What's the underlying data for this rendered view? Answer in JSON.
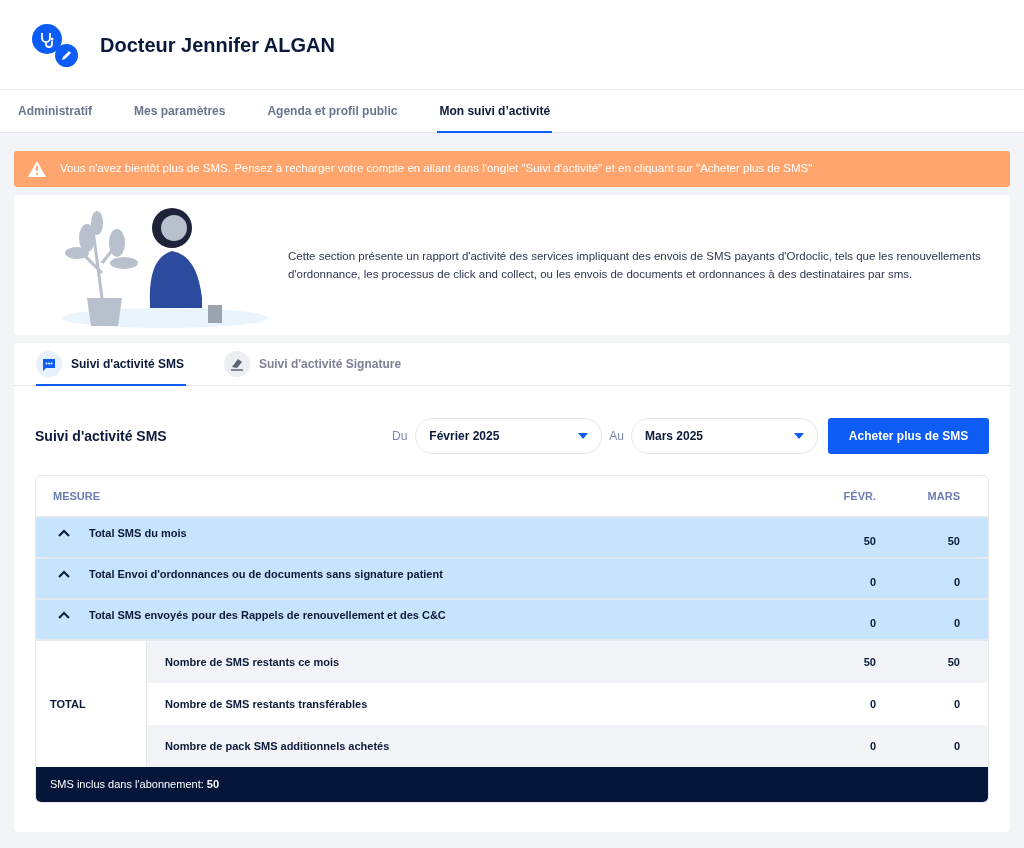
{
  "header": {
    "title": "Docteur Jennifer ALGAN"
  },
  "tabs": [
    {
      "label": "Administratif",
      "selected": false
    },
    {
      "label": "Mes paramètres",
      "selected": false
    },
    {
      "label": "Agenda et profil public",
      "selected": false
    },
    {
      "label": "Mon suivi d’activité",
      "selected": true
    }
  ],
  "alert": {
    "text": "Vous n'avez bientôt plus de SMS. Pensez à recharger votre compte en allant dans l'onglet \"Suivi d'activité\" et en cliquant sur \"Acheter plus de SMS\""
  },
  "intro": {
    "text": "Cette section présente un rapport d'activité des services impliquant des envois de SMS payants d'Ordoclic, tels que les renouvellements d'ordonnance, les processus de click and collect, ou les envois de documents et ordonnances à des destinataires par sms."
  },
  "section_tabs": [
    {
      "label": "Suivi d'activité SMS",
      "kind": "sms",
      "selected": true
    },
    {
      "label": "Suivi d'activité Signature",
      "kind": "signature",
      "selected": false
    }
  ],
  "panel": {
    "title": "Suivi d'activité SMS",
    "from_label": "Du",
    "from_value": "Février 2025",
    "to_label": "Au",
    "to_value": "Mars 2025",
    "buy_button": "Acheter plus de SMS"
  },
  "table": {
    "columns": [
      "MESURE",
      "FÉVR.",
      "MARS"
    ],
    "groups": [
      {
        "label": "Total SMS du mois",
        "expanded": true,
        "values": [
          "50",
          "50"
        ]
      },
      {
        "label": "Total Envoi d'ordonnances ou de documents sans signature patient",
        "expanded": true,
        "values": [
          "0",
          "0"
        ]
      },
      {
        "label": "Total SMS envoyés pour des Rappels de renouvellement et des C&C",
        "expanded": true,
        "values": [
          "0",
          "0"
        ]
      }
    ],
    "total_label": "TOTAL",
    "total_rows": [
      {
        "label": "Nombre de SMS restants ce mois",
        "values": [
          "50",
          "50"
        ]
      },
      {
        "label": "Nombre de SMS restants transférables",
        "values": [
          "0",
          "0"
        ]
      },
      {
        "label": "Nombre de pack SMS additionnels achetés",
        "values": [
          "0",
          "0"
        ]
      }
    ],
    "footer": "SMS inclus dans l'abonnement: **50**"
  }
}
